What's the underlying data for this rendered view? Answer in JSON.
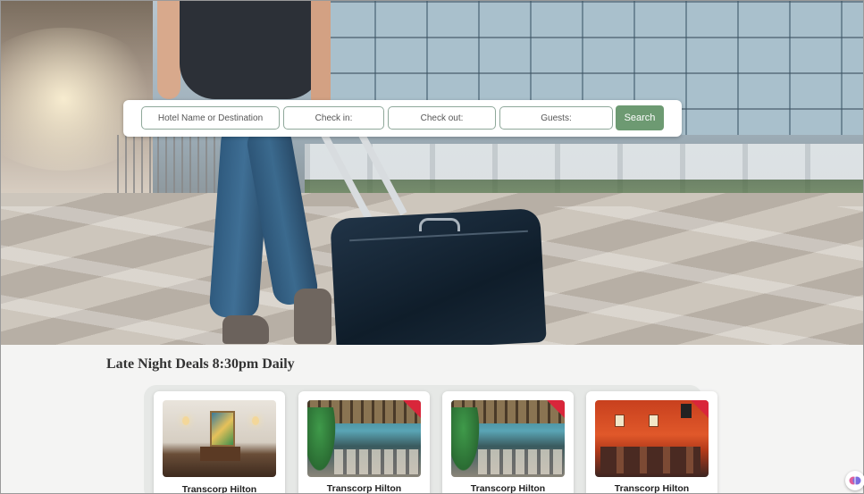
{
  "search": {
    "destination_placeholder": "Hotel Name or Destination",
    "checkin_placeholder": "Check in:",
    "checkout_placeholder": "Check out:",
    "guests_placeholder": "Guests:",
    "button_label": "Search"
  },
  "deals": {
    "title": "Late Night Deals 8:30pm Daily",
    "cards": [
      {
        "name": "Transcorp Hilton",
        "image": "lobby",
        "has_ribbon": false
      },
      {
        "name": "Transcorp Hilton",
        "image": "restaurant",
        "has_ribbon": true
      },
      {
        "name": "Transcorp Hilton",
        "image": "restaurant",
        "has_ribbon": true
      },
      {
        "name": "Transcorp Hilton",
        "image": "red-lounge",
        "has_ribbon": true
      }
    ]
  },
  "colors": {
    "search_button": "#6d9a72",
    "ribbon": "#d9263a",
    "page_background": "#f4f4f3"
  },
  "icons": {
    "floating_button": "brain-icon"
  }
}
